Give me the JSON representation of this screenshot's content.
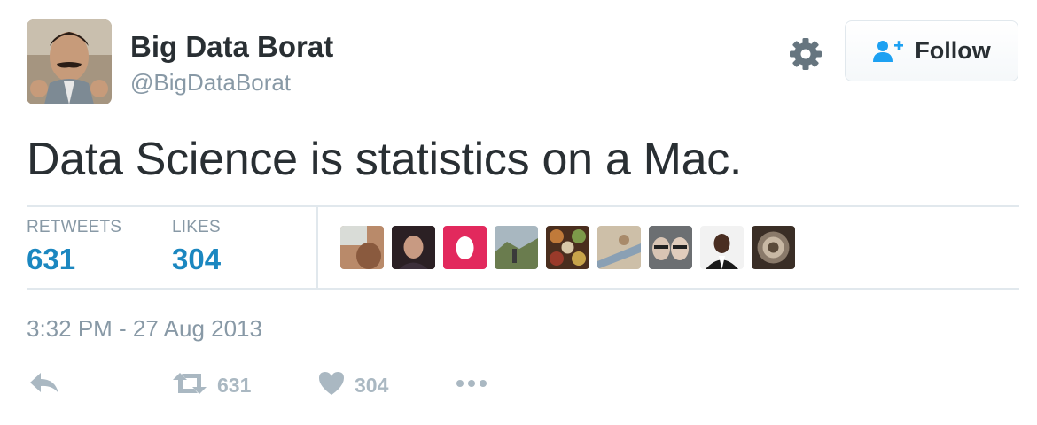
{
  "user": {
    "name": "Big Data Borat",
    "handle": "@BigDataBorat",
    "avatar": "profile-photo"
  },
  "header": {
    "follow_label": "Follow"
  },
  "tweet": {
    "text": "Data Science is statistics on a Mac."
  },
  "stats": {
    "retweets_label": "RETWEETS",
    "retweets_value": "631",
    "likes_label": "LIKES",
    "likes_value": "304"
  },
  "likers": [
    {
      "avatar": "liker-avatar-1"
    },
    {
      "avatar": "liker-avatar-2"
    },
    {
      "avatar": "liker-avatar-3"
    },
    {
      "avatar": "liker-avatar-4"
    },
    {
      "avatar": "liker-avatar-5"
    },
    {
      "avatar": "liker-avatar-6"
    },
    {
      "avatar": "liker-avatar-7"
    },
    {
      "avatar": "liker-avatar-8"
    },
    {
      "avatar": "liker-avatar-9"
    }
  ],
  "timestamp": "3:32 PM - 27 Aug 2013",
  "actions": {
    "retweet_count": "631",
    "like_count": "304"
  },
  "colors": {
    "accent": "#1b87c0",
    "muted": "#8899a6",
    "icon": "#aab8c2",
    "text": "#292f33",
    "follow_icon": "#1da1f2"
  }
}
